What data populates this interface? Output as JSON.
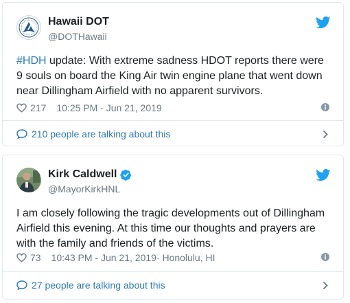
{
  "colors": {
    "link": "#2b7bb9",
    "text": "#1c2022",
    "muted": "#697882",
    "border": "#e1e8ed",
    "twitter_blue": "#1da1f2"
  },
  "tweets": [
    {
      "name": "Hawaii DOT",
      "handle": "@DOTHawaii",
      "verified": false,
      "text_hashtag": "#HDH",
      "text_lines": [
        " update: With extreme sadness HDOT reports there were",
        "9 souls on board the King Air twin engine plane that went down",
        "near Dillingham Airfield with no apparent survivors."
      ],
      "likes": "217",
      "timestamp": "10:25 PM - Jun 21, 2019",
      "location": "",
      "talking": "210 people are talking about this",
      "icons": [
        "hawaii-dot-logo-icon",
        "twitter-bird-icon",
        "heart-icon",
        "info-icon",
        "comment-bubble-icon",
        "chevron-right-icon"
      ]
    },
    {
      "name": "Kirk Caldwell",
      "handle": "@MayorKirkHNL",
      "verified": true,
      "text_lines": [
        "I am closely following the tragic developments out of Dillingham",
        "Airfield this evening. At this time our thoughts and prayers are",
        "with the family and friends of the victims."
      ],
      "likes": "73",
      "timestamp": "10:43 PM - Jun 21, 2019",
      "location": " · Honolulu, HI",
      "talking": "27 people are talking about this",
      "icons": [
        "profile-photo-icon",
        "verified-badge-icon",
        "twitter-bird-icon",
        "heart-icon",
        "info-icon",
        "comment-bubble-icon",
        "chevron-right-icon"
      ]
    }
  ]
}
